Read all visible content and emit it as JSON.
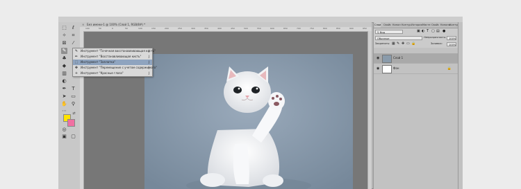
{
  "document": {
    "tab_title": "Без имени-1 @ 100% (Слой 1, RGB/8#) *",
    "ruler_ticks": [
      "100",
      "50",
      "0",
      "50",
      "100",
      "150",
      "200",
      "250",
      "300",
      "350",
      "400",
      "450",
      "500",
      "550",
      "600",
      "650",
      "700",
      "750",
      "800",
      "850",
      "900",
      "950"
    ]
  },
  "flyout": {
    "items": [
      {
        "label": "Инструмент \"Точечная восстанавливающая кисть\"",
        "key": "J",
        "icon": "spot-healing-icon"
      },
      {
        "label": "Инструмент \"Восстанавливающая кисть\"",
        "key": "J",
        "icon": "healing-brush-icon"
      },
      {
        "label": "Инструмент \"Заплатка\"",
        "key": "J",
        "icon": "patch-icon"
      },
      {
        "label": "Инструмент \"Перемещение с учетом содержимого\"",
        "key": "J",
        "icon": "content-aware-move-icon"
      },
      {
        "label": "Инструмент \"Красные глаза\"",
        "key": "J",
        "icon": "red-eye-icon"
      }
    ]
  },
  "panel": {
    "tabs": [
      "Слои",
      "Свойс",
      "Канал",
      "Контур",
      "История",
      "Масте",
      "Свойс",
      "Каналы",
      "Контуры"
    ],
    "search_value": "Вид",
    "blend_mode": "Обычные",
    "opacity_label": "Непрозрачность:",
    "opacity_value": "100%",
    "lock_label": "Закрепить:",
    "fill_label": "Заливка:",
    "fill_value": "100%",
    "layers": [
      {
        "name": "Слой 1",
        "active": true
      },
      {
        "name": "Фон",
        "active": false
      }
    ]
  },
  "colors": {
    "foreground": "#ffe400",
    "background": "#f070a2",
    "canvas_bg": "#8a9bab",
    "kitten": "#f4f4f4"
  }
}
